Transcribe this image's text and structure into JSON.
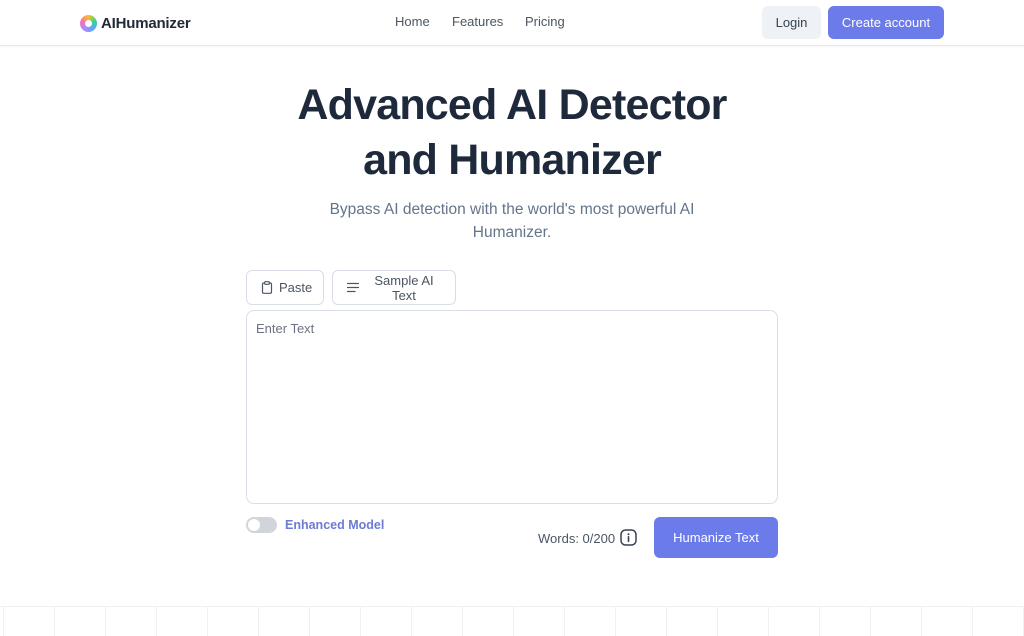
{
  "header": {
    "logo_text": "AIHumanizer",
    "nav": {
      "home": "Home",
      "features": "Features",
      "pricing": "Pricing"
    },
    "login_label": "Login",
    "create_account_label": "Create account"
  },
  "hero": {
    "title_line1": "Advanced AI Detector",
    "title_line2": "and Humanizer",
    "subtitle": "Bypass AI detection with the world's most powerful AI Humanizer."
  },
  "tools": {
    "paste_label": "Paste",
    "sample_label": "Sample AI Text",
    "paste_icon": "clipboard-icon",
    "sample_icon": "lines-icon"
  },
  "editor": {
    "placeholder": "Enter Text",
    "value": ""
  },
  "options": {
    "enhanced_model_label": "Enhanced Model",
    "enhanced_model_on": false,
    "word_count": "Words: 0/200",
    "info_icon": "info-icon"
  },
  "actions": {
    "humanize_label": "Humanize Text"
  },
  "colors": {
    "accent": "#6b7bea",
    "toggle_label": "#6b7bd6",
    "title": "#1e293b",
    "subtitle": "#64748b"
  }
}
